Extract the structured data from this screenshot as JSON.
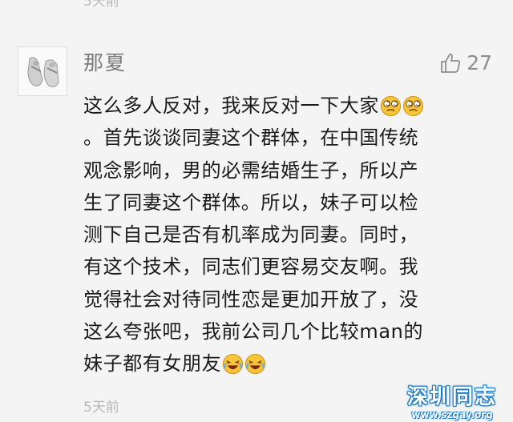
{
  "previous_comment": {
    "timestamp": "5天前"
  },
  "comment": {
    "username": "那夏",
    "like_count": "27",
    "lines": [
      "这么多人反对，我来反对一下大家",
      "。首先谈谈同妻这个群体，在中国传统",
      "观念影响，男的必需结婚生子，所以产",
      "生了同妻这个群体。所以，妹子可以检",
      "测下自己是否有机率成为同妻。同时，",
      "有这个技术，同志们更容易交友啊。我",
      "觉得社会对待同性恋是更加开放了，没",
      "这么夸张吧，我前公司几个比较man的",
      "妹子都有女朋友"
    ],
    "timestamp": "5天前"
  },
  "watermark": {
    "title": "深圳同志",
    "url": "www.szgay.org"
  },
  "icons": {
    "like": "thumbs-up-icon",
    "emoji_line1": "dizzy-eyes-emoji",
    "emoji_line9": "laughing-tears-emoji"
  },
  "colors": {
    "background": "#f4f4f4",
    "username": "#7a7a7a",
    "body_text": "#1b1b1b",
    "timestamp": "#b8b8b8",
    "emoji_yellow": "#f7c43a",
    "watermark_blue": "#1a78c2"
  }
}
